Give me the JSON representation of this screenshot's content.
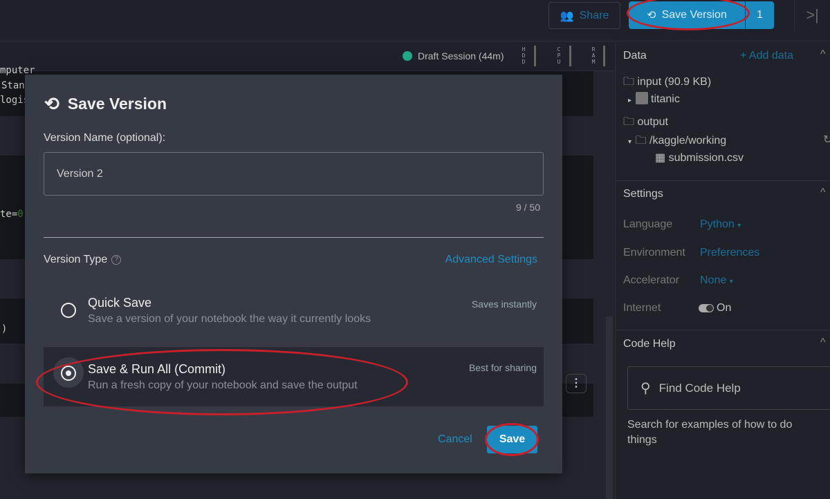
{
  "header": {
    "share_label": "Share",
    "save_version_label": "Save Version",
    "version_count": "1",
    "collapse_icon": "collapse-right-icon"
  },
  "status": {
    "session": "Draft Session (44m)",
    "meters": [
      "HDD",
      "CPU",
      "RAM"
    ],
    "session_color": "#22a884"
  },
  "editor": {
    "code_fragments": [
      "mputer",
      "Stan",
      "logis",
      "te=",
      "0",
      ")",
      ")"
    ]
  },
  "modal": {
    "title": "Save Version",
    "name_label": "Version Name (optional):",
    "name_value": "Version 2",
    "char_count": "9 / 50",
    "type_label": "Version Type",
    "advanced_link": "Advanced Settings",
    "options": [
      {
        "title": "Quick Save",
        "description": "Save a version of your notebook the way it currently looks",
        "note": "Saves instantly",
        "selected": false
      },
      {
        "title": "Save & Run All (Commit)",
        "description": "Run a fresh copy of your notebook and save the output",
        "note": "Best for sharing",
        "selected": true
      }
    ],
    "cancel_label": "Cancel",
    "save_label": "Save"
  },
  "sidebar": {
    "data_title": "Data",
    "add_data": "Add data",
    "input_folder": "input (90.9 KB)",
    "dataset": "titanic",
    "output_folder": "output",
    "working_folder": "/kaggle/working",
    "file": "submission.csv",
    "settings_title": "Settings",
    "settings": [
      {
        "label": "Language",
        "value": "Python"
      },
      {
        "label": "Environment",
        "value": "Preferences"
      },
      {
        "label": "Accelerator",
        "value": "None"
      },
      {
        "label": "Internet",
        "value": "On"
      }
    ],
    "code_help_title": "Code Help",
    "search_placeholder": "Find Code Help",
    "help_text": "Search for examples of how to do things"
  },
  "colors": {
    "accent": "#1a8ac0",
    "annotation": "#c8202a",
    "modal_bg": "#353a45"
  }
}
